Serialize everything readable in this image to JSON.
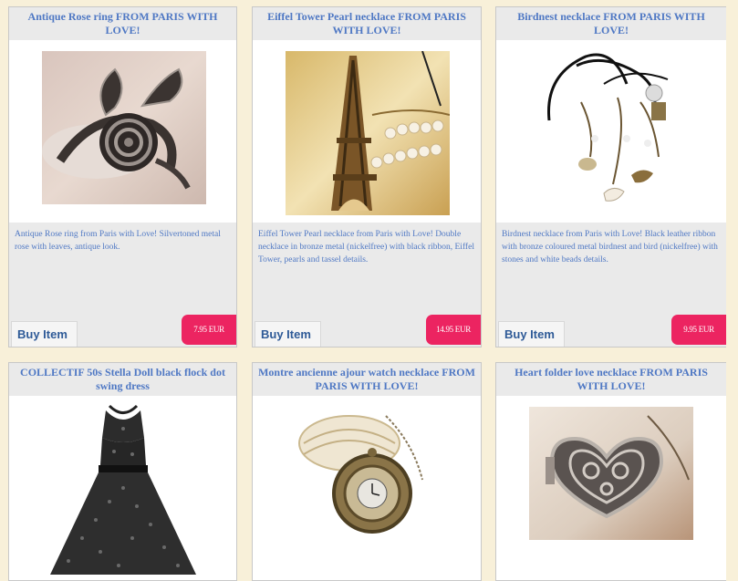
{
  "products": [
    {
      "title": "Antique Rose ring FROM PARIS WITH LOVE!",
      "description": "Antique Rose ring from Paris with Love! Silvertoned metal rose with leaves, antique look.",
      "buy_label": "Buy Item",
      "price": "7.95 EUR",
      "image": "rose-ring-image"
    },
    {
      "title": "Eiffel Tower Pearl necklace FROM PARIS WITH LOVE!",
      "description": "Eiffel Tower Pearl necklace from Paris with Love! Double necklace in bronze metal (nickelfree) with black ribbon, Eiffel Tower, pearls and tassel details.",
      "buy_label": "Buy Item",
      "price": "14.95 EUR",
      "image": "eiffel-necklace-image"
    },
    {
      "title": "Birdnest necklace FROM PARIS WITH LOVE!",
      "description": "Birdnest necklace from Paris with Love! Black leather ribbon with bronze coloured metal birdnest and bird (nickelfree) with stones and white beads details.",
      "buy_label": "Buy Item",
      "price": "9.95 EUR",
      "image": "birdnest-necklace-image"
    },
    {
      "title": "COLLECTIF 50s Stella Doll black flock dot swing dress",
      "image": "polka-dress-image"
    },
    {
      "title": "Montre ancienne ajour watch necklace FROM PARIS WITH LOVE!",
      "image": "pocket-watch-image"
    },
    {
      "title": "Heart folder love necklace FROM PARIS WITH LOVE!",
      "image": "heart-locket-image"
    }
  ],
  "colors": {
    "page_bg": "#f8f0d9",
    "title_text": "#4f78c4",
    "price_badge": "#ec2461",
    "buy_text": "#2e5a97"
  }
}
